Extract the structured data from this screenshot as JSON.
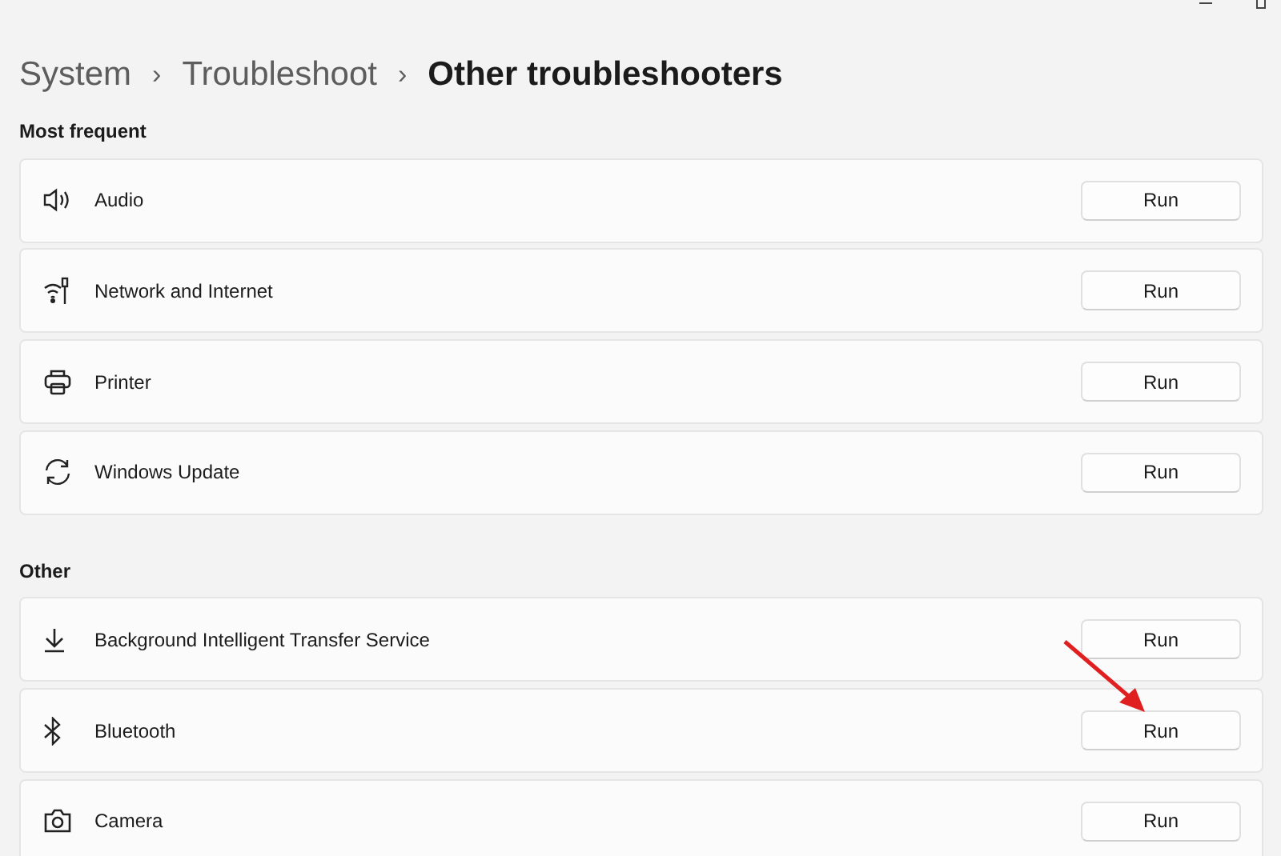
{
  "breadcrumb": [
    {
      "label": "System",
      "current": false
    },
    {
      "label": "Troubleshoot",
      "current": false
    },
    {
      "label": "Other troubleshooters",
      "current": true
    }
  ],
  "breadcrumb_separator": "›",
  "sections": [
    {
      "title": "Most frequent",
      "items": [
        {
          "name": "Audio",
          "button": "Run"
        },
        {
          "name": "Network and Internet",
          "button": "Run"
        },
        {
          "name": "Printer",
          "button": "Run"
        },
        {
          "name": "Windows Update",
          "button": "Run"
        }
      ]
    },
    {
      "title": "Other",
      "items": [
        {
          "name": "Background Intelligent Transfer Service",
          "button": "Run"
        },
        {
          "name": "Bluetooth",
          "button": "Run"
        },
        {
          "name": "Camera",
          "button": "Run"
        }
      ]
    }
  ]
}
